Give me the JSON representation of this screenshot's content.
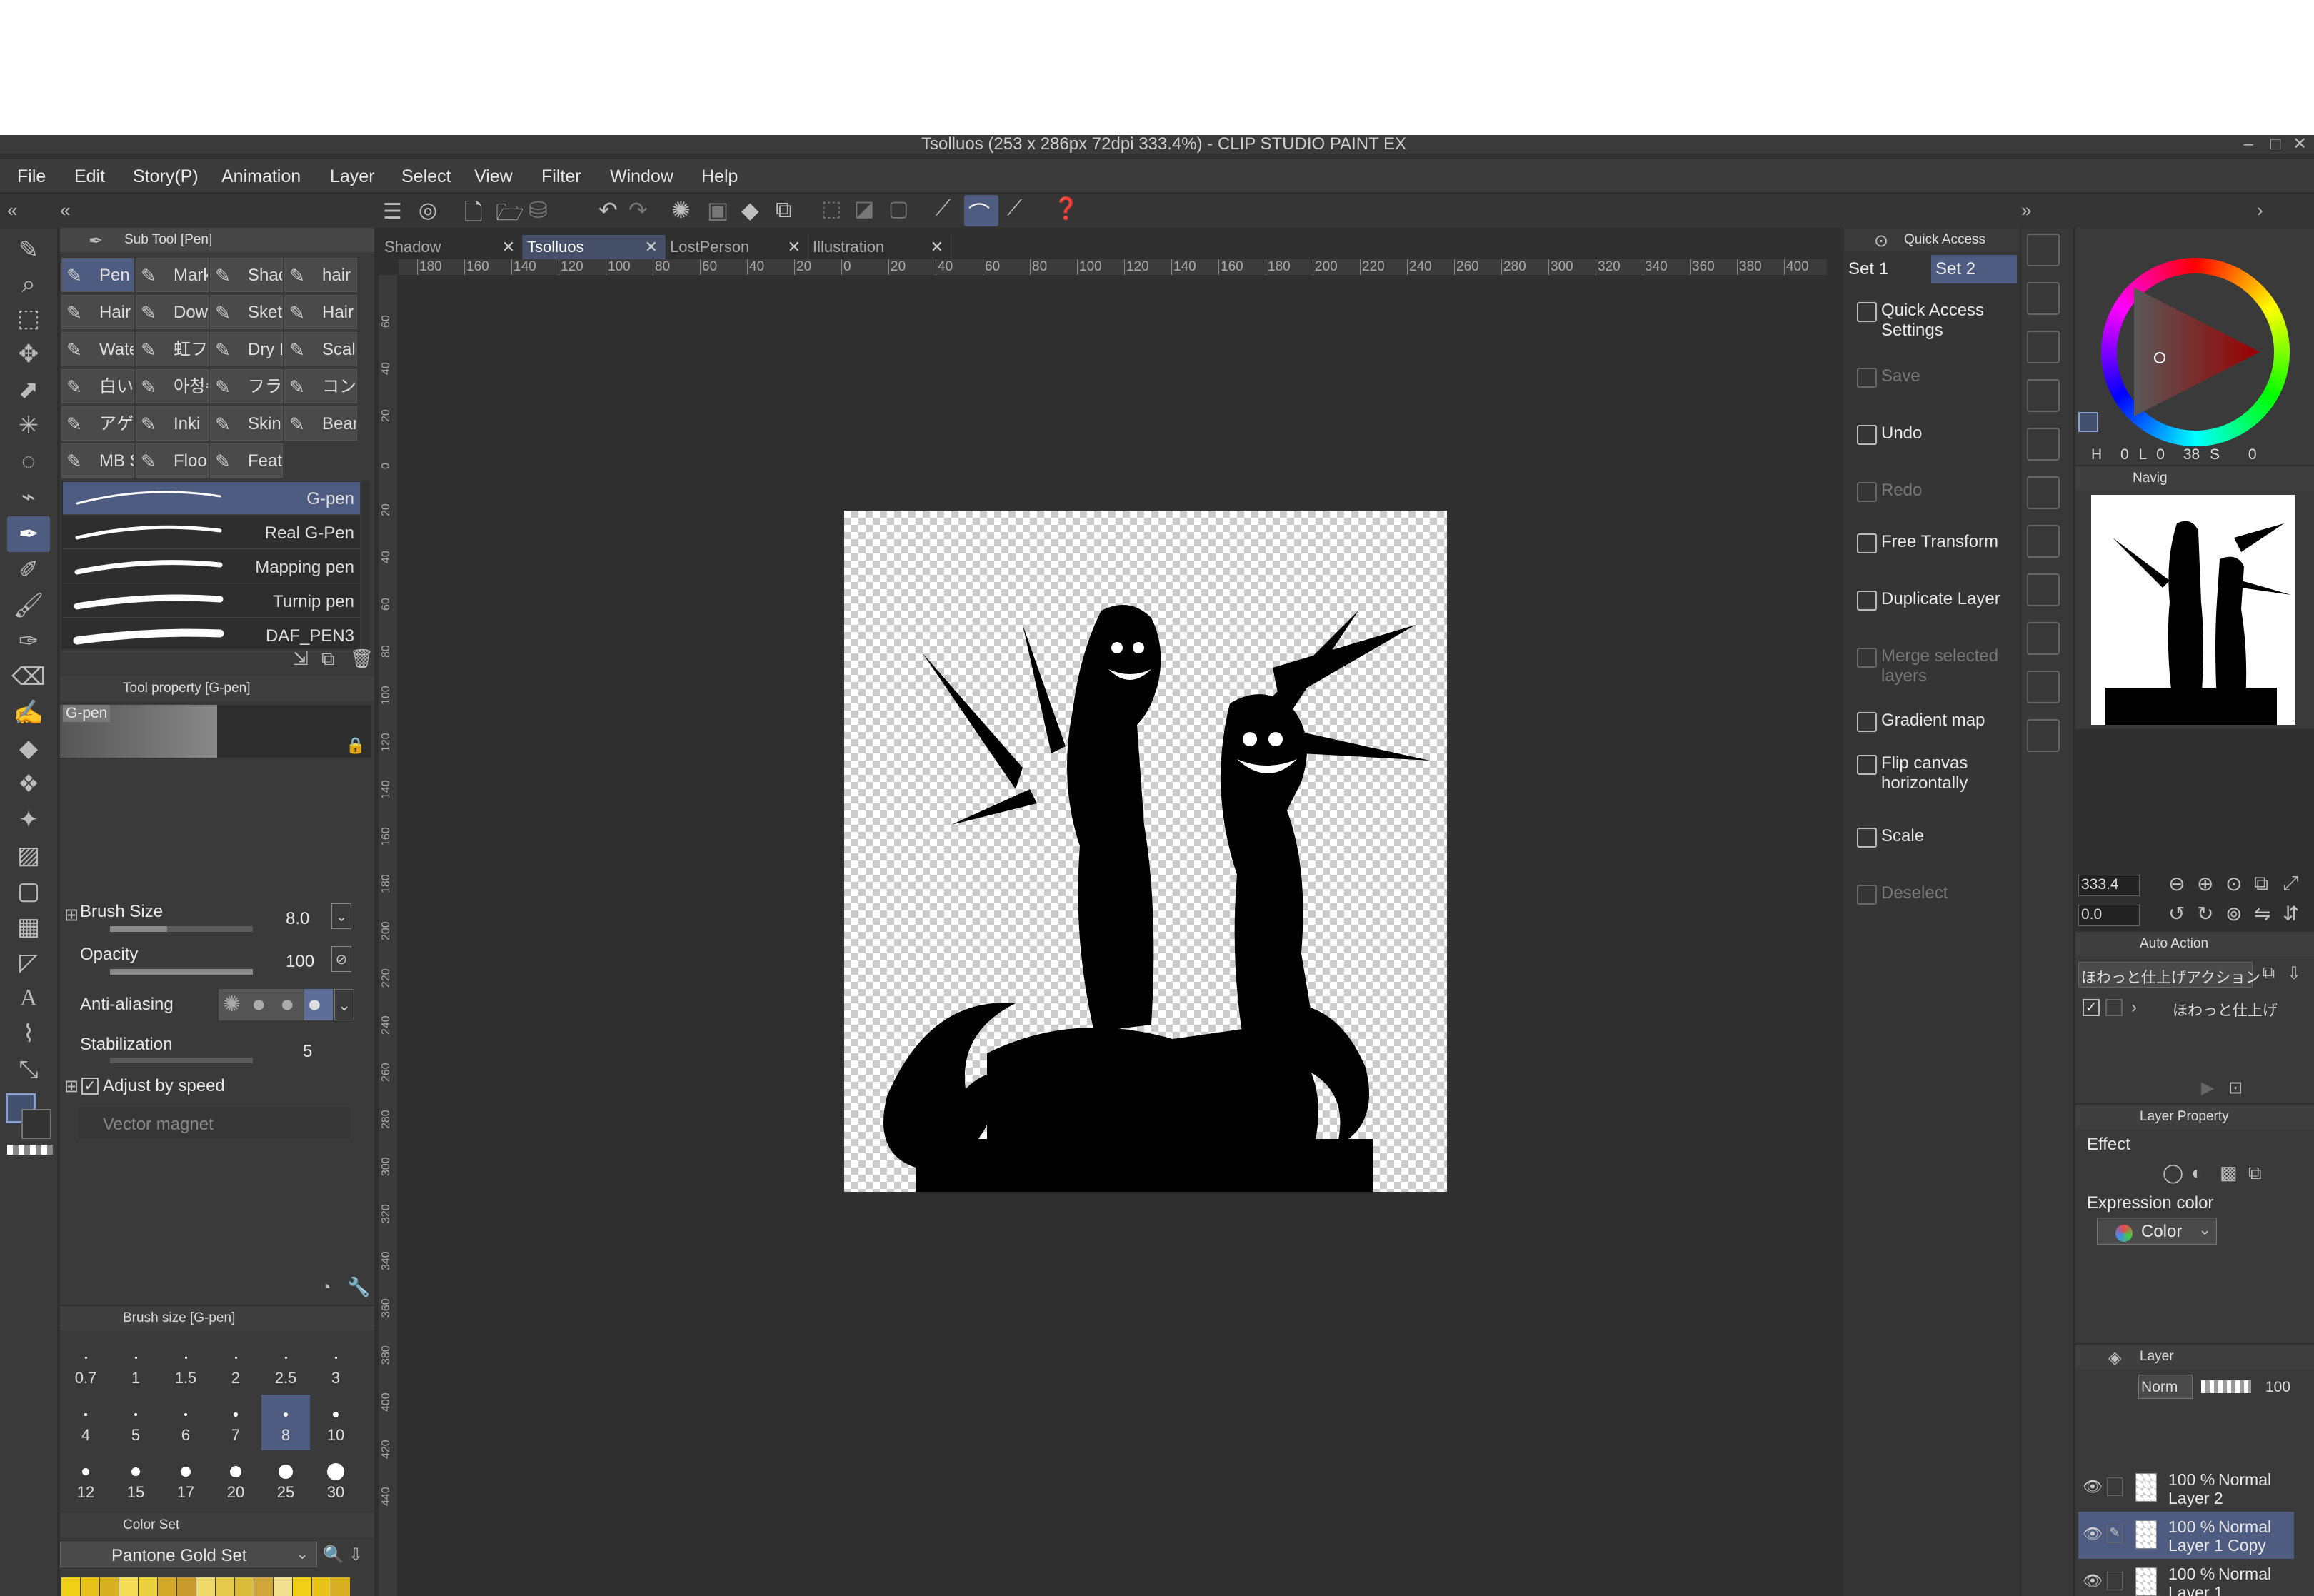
{
  "window": {
    "title": "Tsolluos (253 x 286px 72dpi 333.4%)  - CLIP STUDIO PAINT EX"
  },
  "menu": [
    "File",
    "Edit",
    "Story(P)",
    "Animation",
    "Layer",
    "Select",
    "View",
    "Filter",
    "Window",
    "Help"
  ],
  "doc_tabs": [
    {
      "label": "Shadow",
      "active": false
    },
    {
      "label": "Tsolluos",
      "active": true
    },
    {
      "label": "LostPerson",
      "active": false
    },
    {
      "label": "Illustration",
      "active": false
    }
  ],
  "subtool": {
    "header": "Sub Tool [Pen]",
    "buttons": [
      [
        "Pen",
        "Mark",
        "Shad",
        "hair"
      ],
      [
        "Hair",
        "Dowi",
        "Sketi",
        "Hair"
      ],
      [
        "Wate",
        "虹フラ",
        "Dry B",
        "Scale"
      ],
      [
        "白い",
        "아청수",
        "フラッ",
        "コング"
      ],
      [
        "アゲハ",
        "Inki",
        "Skin",
        "Bean"
      ],
      [
        "MB S",
        "Floo",
        "Feath"
      ]
    ],
    "brushes": [
      "G-pen",
      "Real G-Pen",
      "Mapping pen",
      "Turnip pen",
      "DAF_PEN3"
    ]
  },
  "tool_property": {
    "header": "Tool property [G-pen]",
    "preset": "G-pen",
    "brush_size_label": "Brush Size",
    "brush_size": "8.0",
    "opacity_label": "Opacity",
    "opacity": "100",
    "antialias_label": "Anti-aliasing",
    "stabilization_label": "Stabilization",
    "stabilization": "5",
    "adjust_speed_label": "Adjust by speed",
    "vector_magnet_label": "Vector magnet"
  },
  "brush_size_panel": {
    "header": "Brush size [G-pen]",
    "sizes": [
      "0.7",
      "1",
      "1.5",
      "2",
      "2.5",
      "3",
      "4",
      "5",
      "6",
      "7",
      "8",
      "10",
      "12",
      "15",
      "17",
      "20",
      "25",
      "30"
    ],
    "selected": "8"
  },
  "color_set": {
    "header": "Color Set",
    "name": "Pantone Gold Set"
  },
  "ruler_labels": [
    "180",
    "160",
    "140",
    "120",
    "100",
    "80",
    "60",
    "40",
    "20",
    "0",
    "20",
    "40",
    "60",
    "80",
    "100",
    "120",
    "140",
    "160",
    "180",
    "200",
    "220",
    "240",
    "260",
    "280",
    "300",
    "320",
    "340",
    "360",
    "380",
    "400"
  ],
  "vruler_labels": [
    "60",
    "40",
    "20",
    "0",
    "20",
    "40",
    "60",
    "80",
    "100",
    "120",
    "140",
    "160",
    "180",
    "200",
    "220",
    "240",
    "260",
    "280",
    "300",
    "320",
    "340",
    "360",
    "380",
    "400",
    "420",
    "440"
  ],
  "quick_access": {
    "header": "Quick Access",
    "tabs": [
      "Set 1",
      "Set 2"
    ],
    "items": [
      {
        "label": "Quick Access Settings",
        "enabled": true
      },
      {
        "label": "Save",
        "enabled": false
      },
      {
        "label": "Undo",
        "enabled": true
      },
      {
        "label": "Redo",
        "enabled": false
      },
      {
        "label": "Free Transform",
        "enabled": true
      },
      {
        "label": "Duplicate Layer",
        "enabled": true
      },
      {
        "label": "Merge selected layers",
        "enabled": false
      },
      {
        "label": "Gradient map",
        "enabled": true
      },
      {
        "label": "Flip canvas horizontally",
        "enabled": true
      },
      {
        "label": "Scale",
        "enabled": true
      },
      {
        "label": "Deselect",
        "enabled": false
      }
    ]
  },
  "color_wheel": {
    "values": [
      "0",
      "0",
      "38",
      "0"
    ],
    "labels": [
      "H",
      "L",
      "S"
    ]
  },
  "navigator": {
    "header": "Navig",
    "zoom": "333.4",
    "angle": "0.0"
  },
  "auto_action": {
    "header": "Auto Action",
    "set": "ほわっと仕上げアクション",
    "item": "ほわっと仕上げ"
  },
  "layer_property": {
    "header": "Layer Property",
    "effect_label": "Effect",
    "expression_label": "Expression color",
    "expression_value": "Color"
  },
  "layer_panel": {
    "header": "Layer",
    "blend": "Norm",
    "opacity": "100",
    "layers": [
      {
        "opacity": "100 %",
        "mode": "Normal",
        "name": "Layer 2",
        "selected": false
      },
      {
        "opacity": "100 %",
        "mode": "Normal",
        "name": "Layer 1 Copy",
        "selected": true
      },
      {
        "opacity": "100 %",
        "mode": "Normal",
        "name": "Layer 1",
        "selected": false
      }
    ]
  },
  "colors": {
    "accent": "#465069",
    "panel": "#3a3a3a",
    "canvas_bg": "#2f2f2f"
  }
}
